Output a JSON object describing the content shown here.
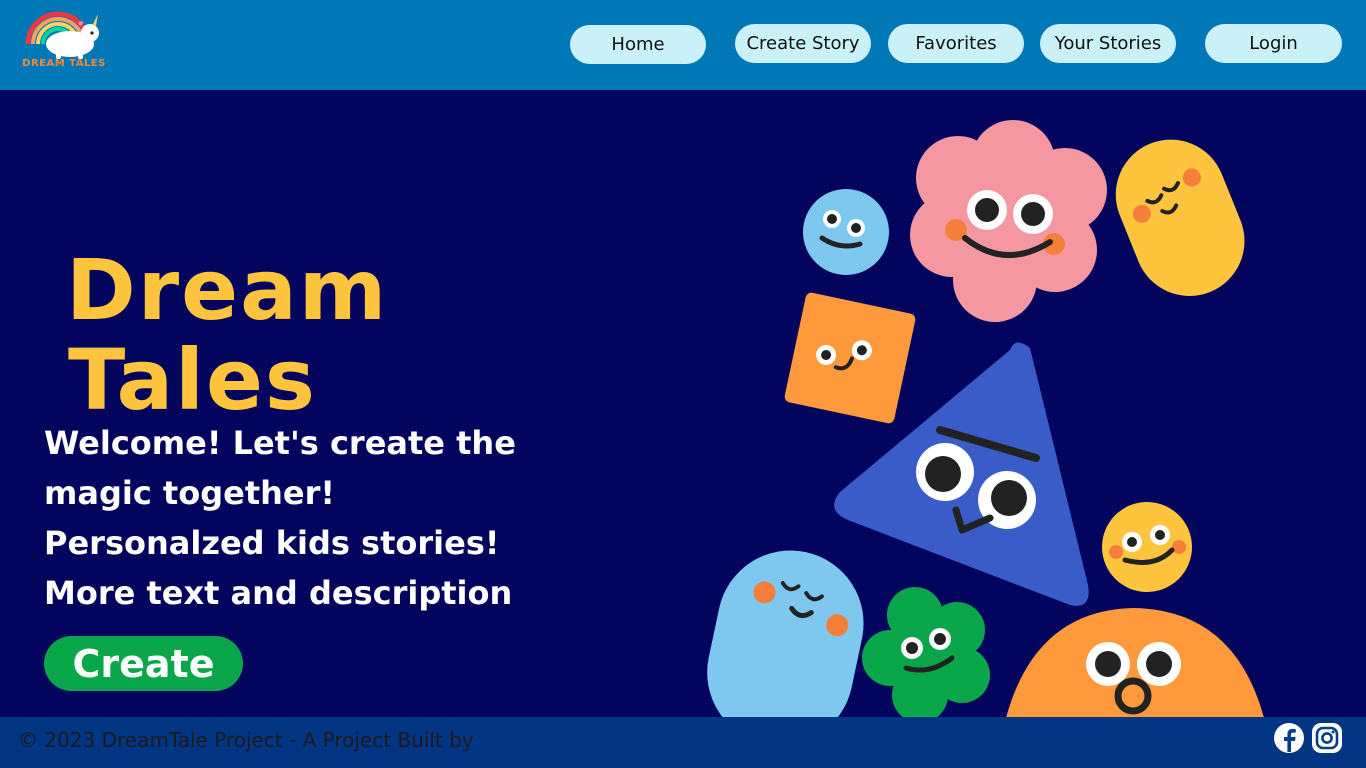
{
  "brand": {
    "logo_text": "DREAM TALES"
  },
  "nav": {
    "items": [
      {
        "label": "Home"
      },
      {
        "label": "Create Story"
      },
      {
        "label": "Favorites"
      },
      {
        "label": "Your Stories"
      },
      {
        "label": "Login"
      }
    ]
  },
  "hero": {
    "title_line1": "Dream",
    "title_line2": "Tales",
    "desc_lines": [
      "Welcome! Let's create the",
      "magic together!",
      "Personalzed kids stories!",
      "More text and description"
    ],
    "cta_label": "Create"
  },
  "footer": {
    "copyright": "© 2023 DreamTale Project - A Project Built by"
  },
  "social": [
    {
      "icon": "facebook-icon"
    },
    {
      "icon": "instagram-icon"
    }
  ],
  "colors": {
    "header_bg": "#0077b6",
    "main_bg": "#03045e",
    "nav_button_bg": "#caf0f8",
    "title_color": "#ffc43d",
    "cta_bg": "#0aa64a",
    "footer_bg": "#023e8a"
  }
}
